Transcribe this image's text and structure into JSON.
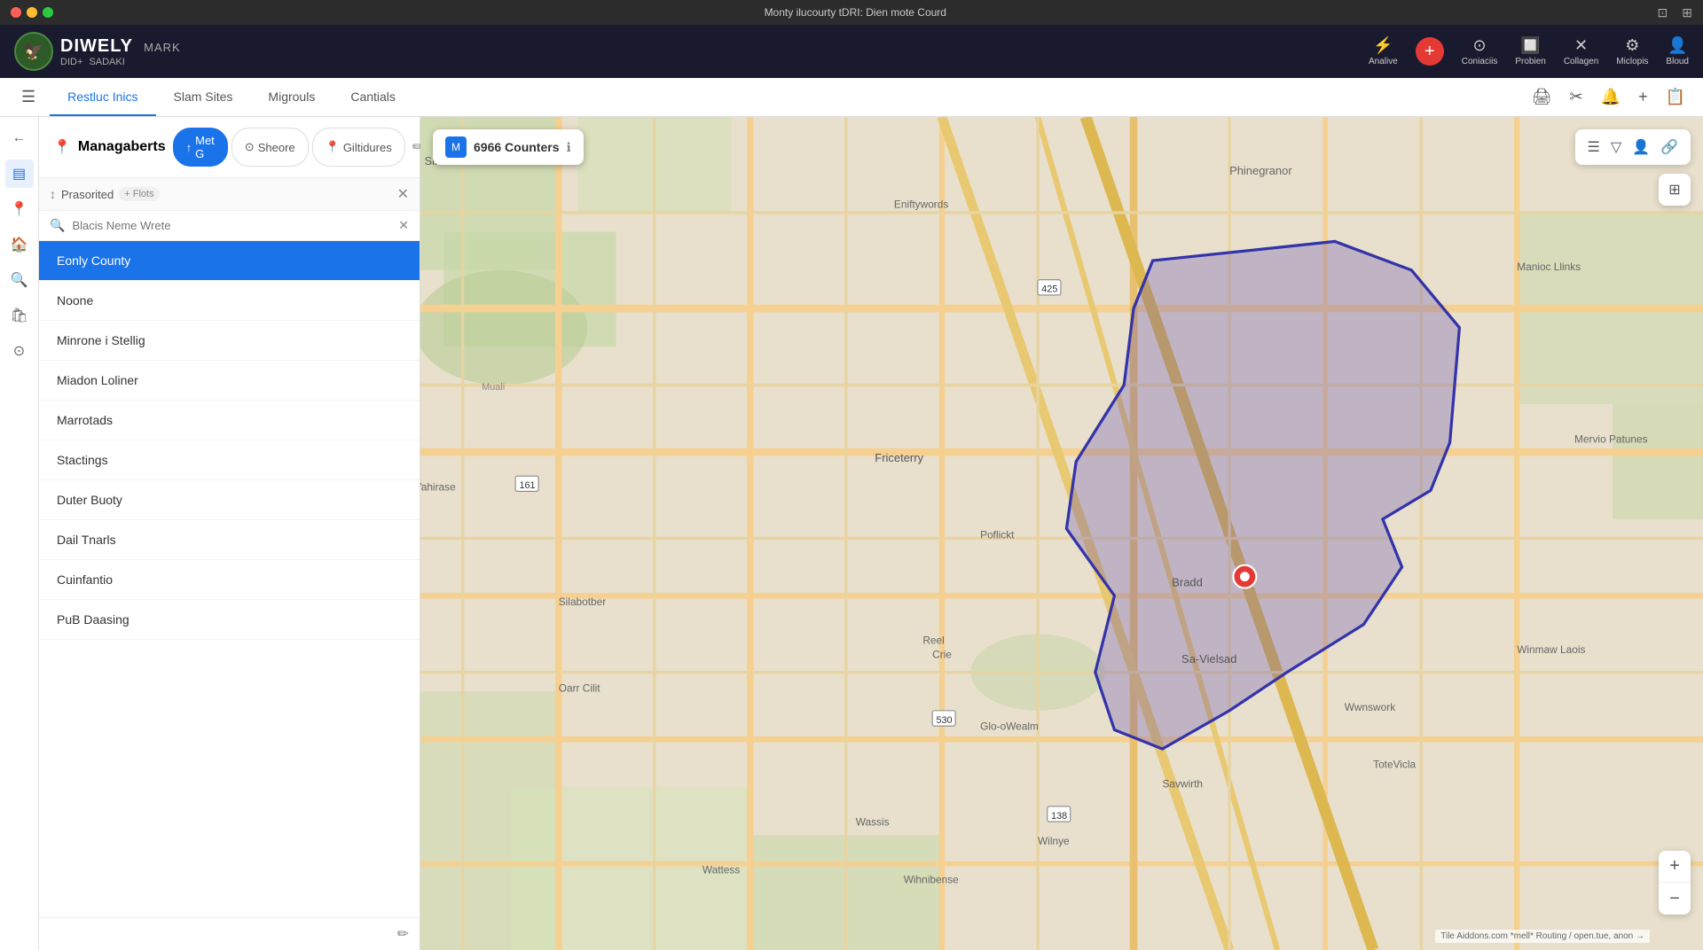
{
  "titlebar": {
    "title": "Monty ilucourty tDRI: Dien mote Courd",
    "dots": [
      "red",
      "yellow",
      "green"
    ]
  },
  "header": {
    "logo_main": "DIWELY",
    "logo_mark": "MARK",
    "logo_sub": "DID+",
    "logo_sub2": "SADAKI",
    "actions": [
      {
        "label": "Analive",
        "icon": "⚡"
      },
      {
        "label": "Coniaciis",
        "icon": "+"
      },
      {
        "label": "Probien",
        "icon": "⊙"
      },
      {
        "label": "Collagen",
        "icon": "✕"
      },
      {
        "label": "Miclopis",
        "icon": "⚙"
      },
      {
        "label": "Bloud",
        "icon": "👤"
      }
    ]
  },
  "navbar": {
    "tabs": [
      {
        "label": "Restluc Inics",
        "active": true
      },
      {
        "label": "Slam Sites",
        "active": false
      },
      {
        "label": "Migrouls",
        "active": false
      },
      {
        "label": "Cantials",
        "active": false
      }
    ],
    "icons": [
      "🖨",
      "✂",
      "🔔",
      "+",
      "📋"
    ]
  },
  "panel": {
    "title": "Managaberts",
    "location_icon": "📍",
    "tabs": [
      {
        "label": "Met G",
        "icon": "↑",
        "active": true
      },
      {
        "label": "Sheore",
        "icon": "⊙",
        "active": false
      },
      {
        "label": "Giltidures",
        "icon": "📍",
        "active": false
      }
    ],
    "search_label": "Prasorited",
    "filter_label": "+ Flots",
    "search_placeholder": "Blacis Neme Wrete",
    "list_items": [
      {
        "label": "Eonly County",
        "selected": true
      },
      {
        "label": "Noone",
        "selected": false
      },
      {
        "label": "Minrone i Stellig",
        "selected": false
      },
      {
        "label": "Miadon Loliner",
        "selected": false
      },
      {
        "label": "Marrotads",
        "selected": false
      },
      {
        "label": "Stactings",
        "selected": false
      },
      {
        "label": "Duter Buoty",
        "selected": false
      },
      {
        "label": "Dail Tnarls",
        "selected": false
      },
      {
        "label": "Cuinfantio",
        "selected": false
      },
      {
        "label": "PuB Daasing",
        "selected": false
      }
    ]
  },
  "map": {
    "bubble_text": "6966 Counters",
    "bubble_icon": "M",
    "info_icon": "ℹ",
    "zoom_in": "+",
    "zoom_out": "−",
    "attribution": "Tile Aiddons.com *mell* Routing / open.tue, anon →"
  },
  "sidebar_icons": [
    {
      "icon": "▲",
      "name": "layers-icon"
    },
    {
      "icon": "📌",
      "name": "pin-icon"
    },
    {
      "icon": "🏠",
      "name": "home-icon"
    },
    {
      "icon": "🔍",
      "name": "search-icon"
    },
    {
      "icon": "🛍",
      "name": "shop-icon"
    },
    {
      "icon": "⊙",
      "name": "circle-icon"
    }
  ]
}
